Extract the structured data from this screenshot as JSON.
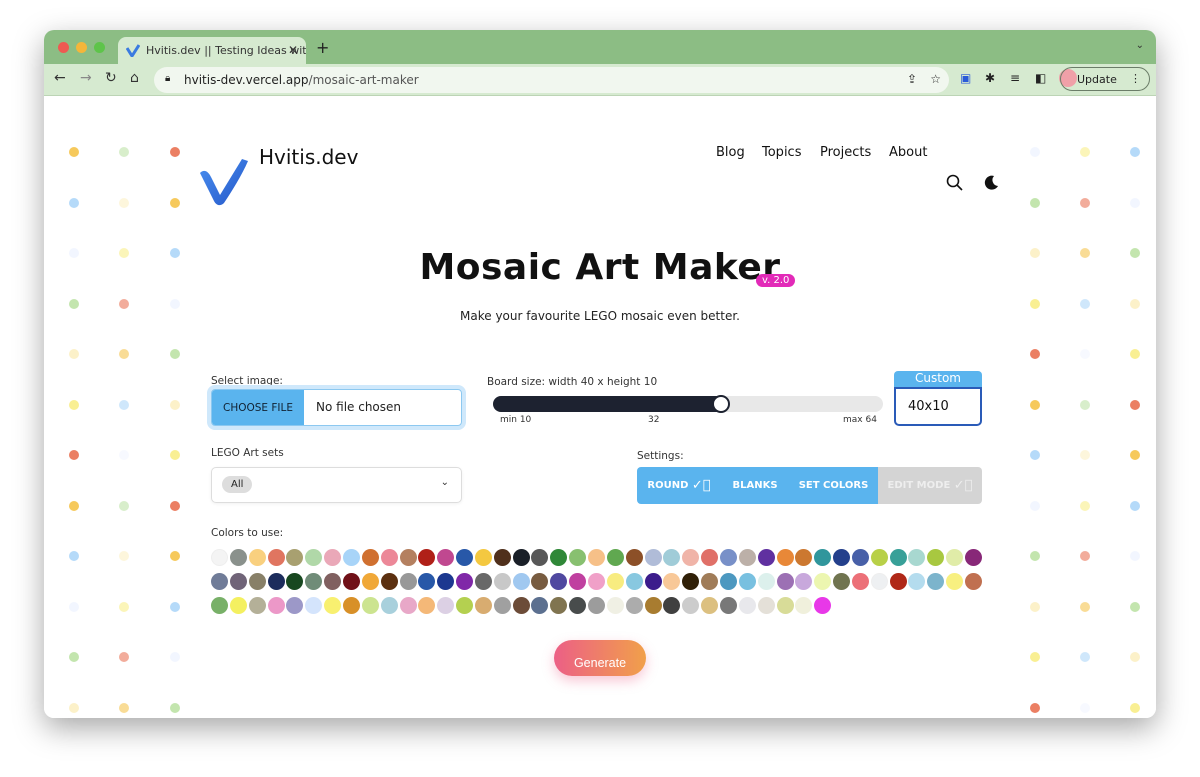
{
  "browser": {
    "tab_title": "Hvitis.dev || Testing Ideas with",
    "url_host": "hvitis-dev.vercel.app",
    "url_path": "/mosaic-art-maker",
    "update_label": "Update",
    "theme_color": "#8cbd84"
  },
  "site": {
    "logo_text": "Hvitis.dev",
    "nav": [
      "Blog",
      "Topics",
      "Projects",
      "About"
    ],
    "nav_icons": [
      "search-icon",
      "moon-icon"
    ]
  },
  "main": {
    "title": "Mosaic Art Maker",
    "version": "v. 2.0",
    "subtitle": "Make your favourite LEGO mosaic even better.",
    "select_image_label": "Select image:",
    "choose_file_label": "CHOOSE FILE",
    "file_status": "No file chosen",
    "board_size_label": "Board size:  width 40 x height 10",
    "slider": {
      "min_label": "min 10",
      "mid_label": "32",
      "max_label": "max 64",
      "min": 10,
      "max": 64,
      "value": 40
    },
    "custom_label": "Custom",
    "custom_value": "40x10",
    "sets_label": "LEGO Art sets",
    "sets_selected": "All",
    "settings_label": "Settings:",
    "settings": [
      {
        "label": "ROUND",
        "active": true,
        "checked": true
      },
      {
        "label": "BLANKS",
        "active": true,
        "checked": false
      },
      {
        "label": "SET COLORS",
        "active": true,
        "checked": false
      },
      {
        "label": "EDIT MODE",
        "active": false,
        "checked": true
      }
    ],
    "colors_label": "Colors to use:",
    "colors": [
      [
        "#f4f4f4",
        "#8a918c",
        "#f9d07f",
        "#e07560",
        "#a8a070",
        "#b0d8a8",
        "#eaa8b8",
        "#a8d4f8",
        "#d07030",
        "#ec8898",
        "#b48060",
        "#b02018",
        "#c04890",
        "#2858a8",
        "#f4c840",
        "#50301c",
        "#1a2028",
        "#585858",
        "#308838",
        "#88c070",
        "#f6c088",
        "#60a850",
        "#8c5028",
        "#b0bcd8",
        "#a0ccd8",
        "#f0b4a8",
        "#e07068",
        "#7890c8",
        "#bcb0a8",
        "#6030a0",
        "#e88838",
        "#cc7830",
        "#30969c",
        "#24408c",
        "#4860a8",
        "#b8d048",
        "#38a098",
        "#a8d8d0",
        "#a8c840",
        "#e0eca8",
        "#882878"
      ],
      [
        "#707c98",
        "#706478",
        "#888068",
        "#1c2c5c",
        "#184820",
        "#708c78",
        "#806060",
        "#701018",
        "#f0a838",
        "#5c3010",
        "#989898",
        "#2858a8",
        "#1c3890",
        "#8028a8",
        "#686868",
        "#c8c8c8",
        "#a0c8f0",
        "#785c40",
        "#5048a0",
        "#c040a0",
        "#f0a0c8",
        "#f8ec80",
        "#88c8e0",
        "#3c1c8c",
        "#f8c898",
        "#302008",
        "#a07c58",
        "#4c98c0",
        "#78c0e0",
        "#dcf0ec",
        "#9c70b4",
        "#c8a8dc",
        "#ecf6b0",
        "#707450",
        "#ec7078",
        "#eef0f2",
        "#b02818",
        "#b4dcee",
        "#7cb4cc",
        "#f8f080",
        "#c07050"
      ],
      [
        "#78b068",
        "#f4f060",
        "#b4b098",
        "#ec98c8",
        "#9c98c8",
        "#d4e4fc",
        "#f8f070",
        "#d89028",
        "#cce490",
        "#a8d0dc",
        "#e8a8c8",
        "#f4b878",
        "#dcd0e4",
        "#b4d050",
        "#d8ac70",
        "#a0a0a0",
        "#6c4c38",
        "#5c7090",
        "#807450",
        "#484c4c",
        "#9c9c9c",
        "#f0f0e4",
        "#acacac",
        "#a87c30",
        "#404040",
        "#cccccc",
        "#dcc080",
        "#787878",
        "#e8e8ec",
        "#e4e0d8",
        "#d8dc98",
        "#f0f0dc",
        "#e838e8"
      ]
    ],
    "generate_label": "Generate",
    "background_dot_colors": [
      "#f4c040",
      "#f8ec80",
      "#b8e0a0",
      "#a8d4f8",
      "#e86848",
      "#fbeec0",
      "#f0f4ff"
    ]
  }
}
